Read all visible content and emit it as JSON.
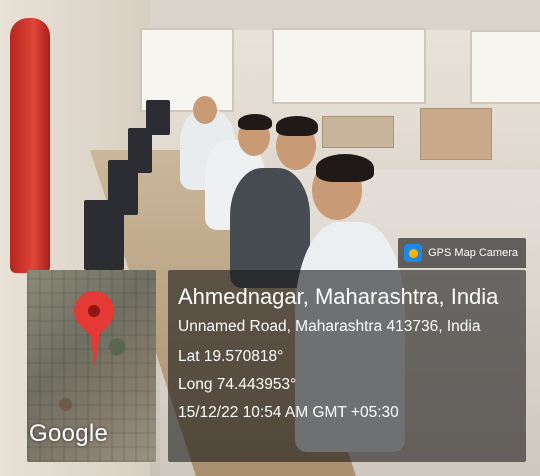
{
  "photo": {
    "description_icon": "photo"
  },
  "map": {
    "attribution": "Google",
    "pin_color": "#e53935"
  },
  "badge": {
    "label": "GPS Map Camera"
  },
  "location": {
    "place": "Ahmednagar, Maharashtra, India",
    "address": "Unnamed Road, Maharashtra 413736, India",
    "latitude": "Lat 19.570818°",
    "longitude": "Long 74.443953°",
    "timestamp": "15/12/22 10:54 AM GMT +05:30"
  }
}
